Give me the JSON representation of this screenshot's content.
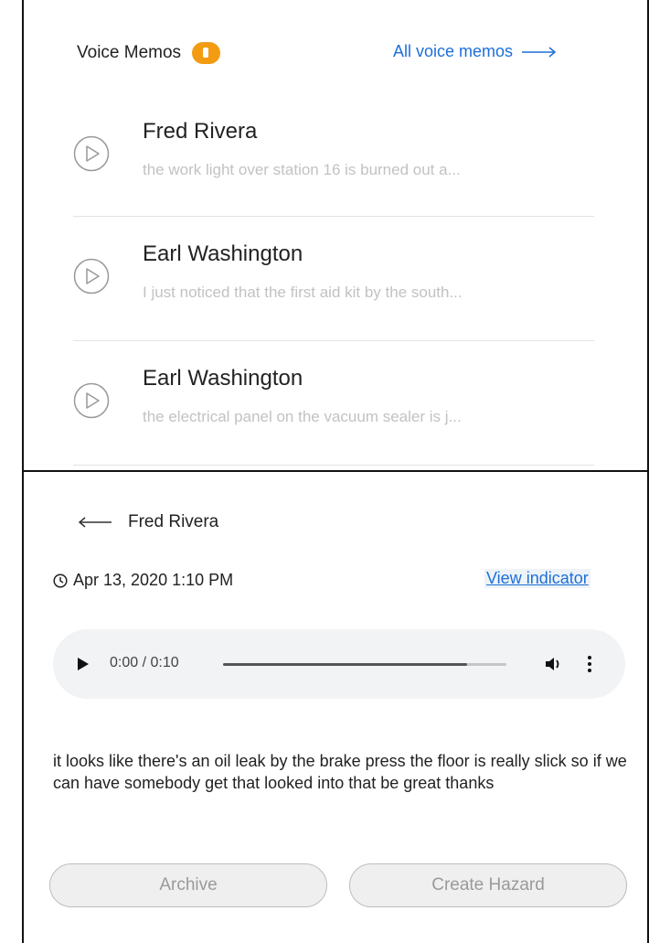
{
  "voice_memos": {
    "title": "Voice Memos",
    "badge_count": "8",
    "all_link_label": "All voice memos",
    "items": [
      {
        "name": "Fred Rivera",
        "preview": "the work light over station 16 is burned out a..."
      },
      {
        "name": "Earl Washington",
        "preview": "I just noticed that the first aid kit by the south..."
      },
      {
        "name": "Earl Washington",
        "preview": "the electrical panel on the vacuum sealer is j..."
      }
    ]
  },
  "detail": {
    "name": "Fred Rivera",
    "datetime": "Apr 13, 2020 1:10 PM",
    "view_indicator_label": "View indicator",
    "audio": {
      "time": "0:00 / 0:10",
      "progress": 0.86
    },
    "transcript": "it looks like there's an oil leak by the brake press the floor is really slick so if we can have somebody get that looked into that be great thanks",
    "archive_label": "Archive",
    "create_hazard_label": "Create Hazard"
  },
  "colors": {
    "accent": "#1e6fd9",
    "badge": "#f39c12"
  }
}
